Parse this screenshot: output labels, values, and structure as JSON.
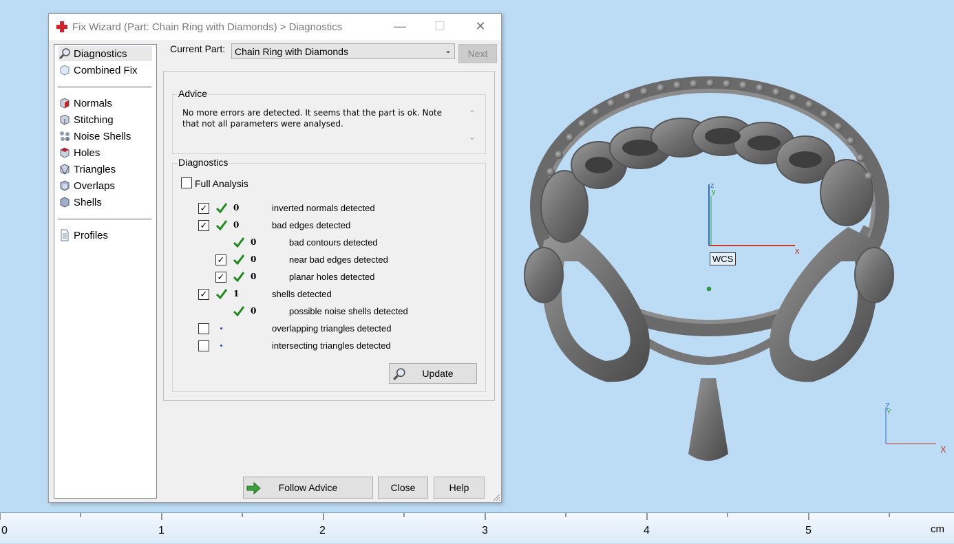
{
  "window": {
    "title": "Fix Wizard (Part: Chain Ring with Diamonds) > Diagnostics",
    "minimize": "—",
    "maximize": "☐",
    "close": "✕"
  },
  "nav": {
    "items": [
      {
        "label": "Diagnostics",
        "icon": "magnifier-icon"
      },
      {
        "label": "Combined Fix",
        "icon": "cube-icon"
      },
      {
        "label": "Normals",
        "icon": "normals-cube-icon"
      },
      {
        "label": "Stitching",
        "icon": "stitching-cube-icon"
      },
      {
        "label": "Noise Shells",
        "icon": "noise-shells-icon"
      },
      {
        "label": "Holes",
        "icon": "holes-cube-icon"
      },
      {
        "label": "Triangles",
        "icon": "triangles-cube-icon"
      },
      {
        "label": "Overlaps",
        "icon": "overlaps-cube-icon"
      },
      {
        "label": "Shells",
        "icon": "shells-cube-icon"
      },
      {
        "label": "Profiles",
        "icon": "document-icon"
      }
    ]
  },
  "part": {
    "label": "Current Part:",
    "value": "Chain Ring with Diamonds",
    "next": "Next"
  },
  "advice": {
    "title": "Advice",
    "text": "No more errors are detected. It seems that the part is ok. Note that not all parameters were analysed."
  },
  "diagnostics": {
    "title": "Diagnostics",
    "full_analysis": "Full Analysis",
    "rows": [
      {
        "checkbox": "checked",
        "status": "check",
        "count": "0",
        "label": "inverted normals detected"
      },
      {
        "checkbox": "checked",
        "status": "check",
        "count": "0",
        "label": "bad edges detected"
      },
      {
        "checkbox": "none",
        "status": "check",
        "count": "0",
        "label": "bad contours detected"
      },
      {
        "checkbox": "checked",
        "status": "check",
        "count": "0",
        "label": "near bad edges detected"
      },
      {
        "checkbox": "checked",
        "status": "check",
        "count": "0",
        "label": "planar holes detected"
      },
      {
        "checkbox": "checked",
        "status": "check",
        "count": "1",
        "label": "shells detected"
      },
      {
        "checkbox": "none",
        "status": "check",
        "count": "0",
        "label": "possible noise shells detected"
      },
      {
        "checkbox": "unchecked",
        "status": "dot",
        "count": "",
        "label": "overlapping triangles detected"
      },
      {
        "checkbox": "unchecked",
        "status": "dot",
        "count": "",
        "label": "intersecting triangles detected"
      }
    ],
    "update": "Update"
  },
  "buttons": {
    "follow_advice": "Follow Advice",
    "close": "Close",
    "help": "Help"
  },
  "viewport": {
    "wcs_label": "WCS",
    "axis_x": "x",
    "axis_y": "y",
    "axis_z": "z",
    "corner_x": "X",
    "corner_y": "Y",
    "corner_z": "Z"
  },
  "ruler": {
    "labels": [
      "0",
      "1",
      "2",
      "3",
      "4",
      "5"
    ],
    "unit": "cm"
  },
  "colors": {
    "background": "#bcdcf6",
    "check_green": "#1e8a1e",
    "axis_red": "#c0392b",
    "axis_green": "#2ea82e",
    "axis_blue": "#2e6fd8"
  }
}
